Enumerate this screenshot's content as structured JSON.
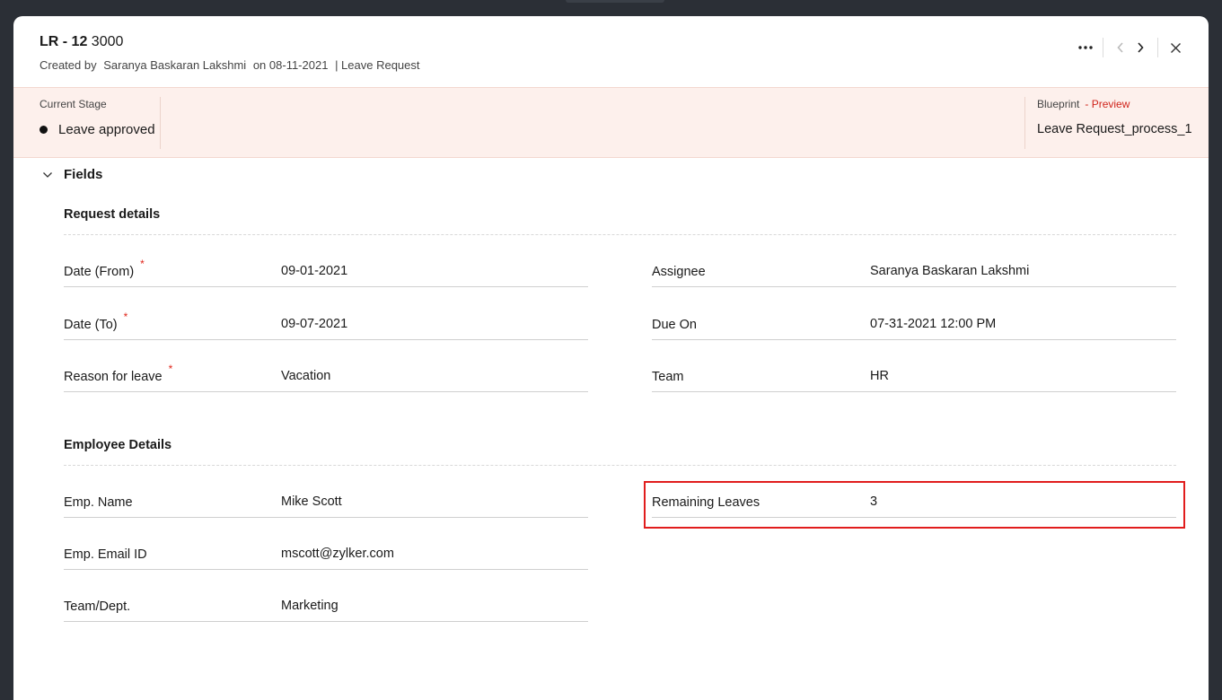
{
  "record": {
    "id": "LR - 12",
    "number": "3000",
    "created_prefix": "Created by",
    "created_by": "Saranya Baskaran Lakshmi",
    "created_on": "on 08-11-2021",
    "layout": "| Leave Request"
  },
  "stage": {
    "label": "Current Stage",
    "value": "Leave approved"
  },
  "blueprint": {
    "label": "Blueprint",
    "preview": "- Preview",
    "value": "Leave Request_process_1"
  },
  "fields": {
    "header": "Fields",
    "request_details": {
      "title": "Request details",
      "left": [
        {
          "label": "Date (From)",
          "required": "*",
          "value": "09-01-2021"
        },
        {
          "label": "Date (To)",
          "required": "*",
          "value": "09-07-2021"
        },
        {
          "label": "Reason for leave",
          "required": "*",
          "value": "Vacation"
        }
      ],
      "right": [
        {
          "label": "Assignee",
          "value": "Saranya Baskaran Lakshmi"
        },
        {
          "label": "Due On",
          "value": "07-31-2021 12:00 PM"
        },
        {
          "label": "Team",
          "value": "HR"
        }
      ]
    },
    "employee_details": {
      "title": "Employee Details",
      "left": [
        {
          "label": "Emp. Name",
          "value": "Mike Scott"
        },
        {
          "label": "Emp. Email ID",
          "value": "mscott@zylker.com"
        },
        {
          "label": "Team/Dept.",
          "value": "Marketing"
        }
      ],
      "right": [
        {
          "label": "Remaining Leaves",
          "value": "3"
        }
      ]
    }
  },
  "icons": {
    "more": "more-horizontal-icon",
    "prev": "chevron-left-icon",
    "next": "chevron-right-icon",
    "close": "close-icon",
    "collapse": "chevron-down-icon"
  },
  "colors": {
    "stage_bg": "#fdf0ec",
    "preview_red": "#d0241b",
    "required_red": "#e0261b",
    "highlight_red": "#e11d1d"
  }
}
